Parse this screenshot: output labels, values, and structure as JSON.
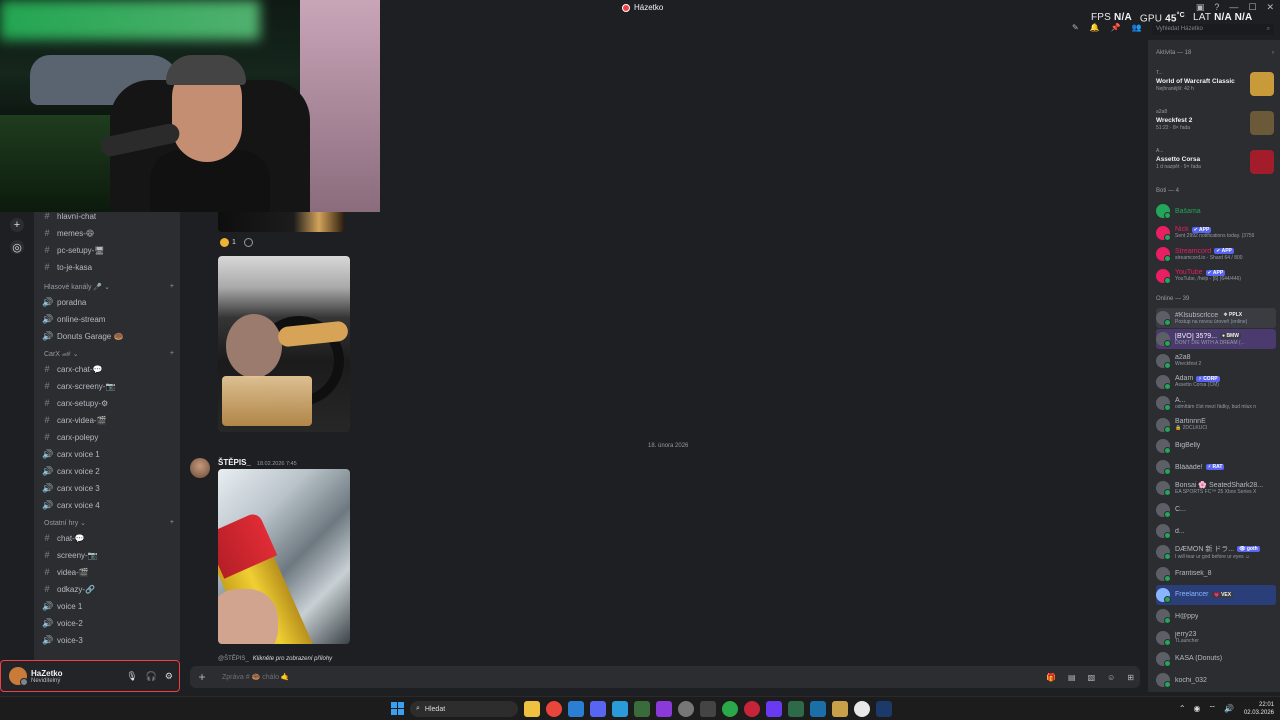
{
  "window": {
    "title": "Házetko"
  },
  "overlay": {
    "fps_label": "FPS",
    "fps_value": "N/A",
    "gpu_label": "GPU",
    "gpu_value": "45",
    "gpu_unit": "°C",
    "lat_label": "LAT",
    "lat_value1": "N/A",
    "lat_value2": "N/A"
  },
  "header": {
    "search_placeholder": "Vyhledat Házetko"
  },
  "channels": {
    "top": [
      {
        "label": "hlavní-chat",
        "icon": "#"
      },
      {
        "label": "memes-😄",
        "icon": "#"
      },
      {
        "label": "pc-setupy-🖥",
        "icon": "#"
      },
      {
        "label": "to-je-kasa",
        "icon": "#"
      }
    ],
    "voice_category": "Hlasové kanály 🎤 ⌄",
    "voice": [
      {
        "label": "poradna",
        "icon": "🔊"
      },
      {
        "label": "online-stream",
        "icon": "🔊"
      },
      {
        "label": "Donuts Garage 🍩",
        "icon": "🔊"
      }
    ],
    "carx_category": "CarX 🏎 ⌄",
    "carx": [
      {
        "label": "carx-chat-💬",
        "icon": "#"
      },
      {
        "label": "carx-screeny-📷",
        "icon": "#"
      },
      {
        "label": "carx-setupy-⚙",
        "icon": "#"
      },
      {
        "label": "carx-videa-🎬",
        "icon": "#"
      },
      {
        "label": "carx-polepy",
        "icon": "#"
      },
      {
        "label": "carx voice 1",
        "icon": "🔊"
      },
      {
        "label": "carx voice 2",
        "icon": "🔊"
      },
      {
        "label": "carx voice 3",
        "icon": "🔊"
      },
      {
        "label": "carx voice 4",
        "icon": "🔊"
      }
    ],
    "other_category": "Ostatní hry ⌄",
    "other": [
      {
        "label": "chat-💬",
        "icon": "#"
      },
      {
        "label": "screeny-📷",
        "icon": "#"
      },
      {
        "label": "videa-🎬",
        "icon": "#"
      },
      {
        "label": "odkazy-🔗",
        "icon": "#"
      },
      {
        "label": "voice 1",
        "icon": "🔊"
      },
      {
        "label": "voice-2",
        "icon": "🔊"
      },
      {
        "label": "voice-3",
        "icon": "🔊"
      }
    ]
  },
  "user": {
    "name": "HaZetko",
    "status": "Neviditelný"
  },
  "messages": {
    "reaction_count": "1",
    "date_divider": "18. února 2026",
    "author": "ŠTĚPIS_",
    "timestamp": "18.02.2026 7:45",
    "reply_author": "@ŠTĚPIS_",
    "reply_text": "Klikněte pro zobrazení přílohy"
  },
  "composer": {
    "placeholder": "Zpráva # 🍩 chálo 🤙"
  },
  "members": {
    "activity_header": "Aktivita — 18",
    "activities": [
      {
        "user": "T...",
        "game": "World of Warcraft Classic",
        "meta": "Nejhranější: 42 h",
        "art_color": "#c89a3a"
      },
      {
        "user": "a2a8",
        "game": "Wreckfest 2",
        "meta": "51:22 · 8× řada",
        "art_color": "#6b5a3a"
      },
      {
        "user": "A...",
        "game": "Assetto Corsa",
        "meta": "1 d nazpět · 9× řada",
        "art_color": "#a21c2a"
      }
    ],
    "bots_header": "Boti — 4",
    "bots": [
      {
        "name": "Bašama",
        "status": "",
        "color": "#23a55a",
        "tag": ""
      },
      {
        "name": "Nick",
        "status": "Sent 2992 notifications today. (3759",
        "color": "#e91e63",
        "tag": "✔ APP"
      },
      {
        "name": "Streamcord",
        "status": "streamcord.io - Shard 64 / 800",
        "color": "#e91e63",
        "tag": "✔ APP"
      },
      {
        "name": "YouTube",
        "status": "YouTube, /help - [6] (644/446)",
        "color": "#e91e63",
        "tag": "✔ APP"
      }
    ],
    "online_header": "Online — 39",
    "online": [
      {
        "name": "#Klsubscrlcce",
        "status": "Postup na novou úroveň (online)",
        "tag": "❖ PPLX",
        "color": "#b5bac1"
      },
      {
        "name": "[BVO] 35?9...",
        "status": "DON'T DIE WITH A DREAM (...",
        "tag": "● BMW",
        "color": "#f2f3f5"
      },
      {
        "name": "a2a8",
        "status": "Wreckfest 2",
        "tag": "",
        "color": "#b5bac1"
      },
      {
        "name": "Adam",
        "status": "Assetto Corsa (CM)",
        "tag": "⚡ CORP",
        "color": "#b5bac1"
      },
      {
        "name": "A...",
        "status": "odmítám číst mezi řádky, bud mlux n",
        "tag": "",
        "color": "#b5bac1"
      },
      {
        "name": "BartinnnE",
        "status": "🔒 2DCLKUCI",
        "tag": "",
        "color": "#b5bac1"
      },
      {
        "name": "BigBelly",
        "status": "",
        "tag": "",
        "color": "#b5bac1"
      },
      {
        "name": "Bláááde!",
        "status": "",
        "tag": "⚡ RAT",
        "color": "#b5bac1"
      },
      {
        "name": "Bonsai 🌸 SeatedShark28...",
        "status": "EA SPORTS FC™ 25 Xbox Series X",
        "tag": "",
        "color": "#b5bac1"
      },
      {
        "name": "C...",
        "status": "",
        "tag": "",
        "color": "#b5bac1"
      },
      {
        "name": "d...",
        "status": "",
        "tag": "",
        "color": "#b5bac1"
      },
      {
        "name": "DÆMON 新 ドラ...",
        "status": "I will tear ur god before ur eyes ☺",
        "tag": "👁 goth",
        "color": "#b5bac1"
      },
      {
        "name": "Frantisek_8",
        "status": "",
        "tag": "",
        "color": "#b5bac1"
      },
      {
        "name": "Freelancer",
        "status": "",
        "tag": "💗 VEX",
        "color": "#8ab4ff"
      },
      {
        "name": "H@ppy",
        "status": "",
        "tag": "",
        "color": "#b5bac1"
      },
      {
        "name": "jerry23",
        "status": "TLauncher",
        "tag": "",
        "color": "#b5bac1"
      },
      {
        "name": "KASA (Donuts)",
        "status": "",
        "tag": "",
        "color": "#b5bac1"
      },
      {
        "name": "kochi_032",
        "status": "",
        "tag": "",
        "color": "#b5bac1"
      }
    ]
  },
  "taskbar": {
    "search_label": "Hledat",
    "time": "22:01",
    "date": "02.03.2026"
  }
}
